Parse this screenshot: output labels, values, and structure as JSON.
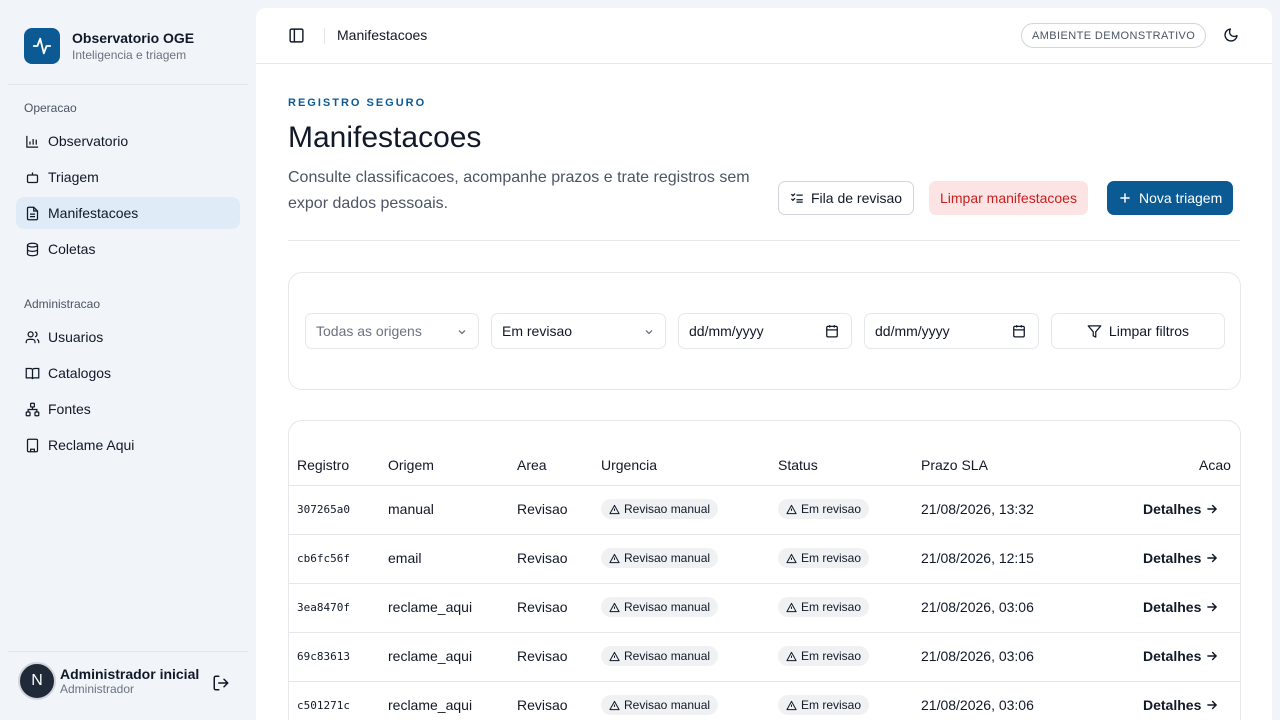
{
  "brand": {
    "title": "Observatorio OGE",
    "subtitle": "Inteligencia e triagem"
  },
  "sidebar": {
    "groups": [
      {
        "label": "Operacao",
        "items": [
          "Observatorio",
          "Triagem",
          "Manifestacoes",
          "Coletas"
        ]
      },
      {
        "label": "Administracao",
        "items": [
          "Usuarios",
          "Catalogos",
          "Fontes",
          "Reclame Aqui"
        ]
      }
    ],
    "active_item": "Manifestacoes"
  },
  "user": {
    "initial": "N",
    "name": "Administrador inicial",
    "role": "Administrador"
  },
  "topbar": {
    "title": "Manifestacoes",
    "env_badge": "AMBIENTE DEMONSTRATIVO"
  },
  "page": {
    "eyebrow": "REGISTRO SEGURO",
    "title": "Manifestacoes",
    "description": "Consulte classificacoes, acompanhe prazos e trate registros sem expor dados pessoais.",
    "actions": {
      "review_queue": "Fila de revisao",
      "clear_records": "Limpar manifestacoes",
      "new_triage": "Nova triagem"
    }
  },
  "filters": {
    "origin": {
      "value": "Todas as origens"
    },
    "status": {
      "value": "Em revisao"
    },
    "date_from": {
      "placeholder": "dd/mm/yyyy"
    },
    "date_to": {
      "placeholder": "dd/mm/yyyy"
    },
    "clear_label": "Limpar filtros"
  },
  "table": {
    "columns": [
      "Registro",
      "Origem",
      "Area",
      "Urgencia",
      "Status",
      "Prazo SLA",
      "Acao"
    ],
    "rows": [
      {
        "registro": "307265a0",
        "origem": "manual",
        "area": "Revisao",
        "urgencia": "Revisao manual",
        "status": "Em revisao",
        "prazo": "21/08/2026, 13:32",
        "acao": "Detalhes"
      },
      {
        "registro": "cb6fc56f",
        "origem": "email",
        "area": "Revisao",
        "urgencia": "Revisao manual",
        "status": "Em revisao",
        "prazo": "21/08/2026, 12:15",
        "acao": "Detalhes"
      },
      {
        "registro": "3ea8470f",
        "origem": "reclame_aqui",
        "area": "Revisao",
        "urgencia": "Revisao manual",
        "status": "Em revisao",
        "prazo": "21/08/2026, 03:06",
        "acao": "Detalhes"
      },
      {
        "registro": "69c83613",
        "origem": "reclame_aqui",
        "area": "Revisao",
        "urgencia": "Revisao manual",
        "status": "Em revisao",
        "prazo": "21/08/2026, 03:06",
        "acao": "Detalhes"
      },
      {
        "registro": "c501271c",
        "origem": "reclame_aqui",
        "area": "Revisao",
        "urgencia": "Revisao manual",
        "status": "Em revisao",
        "prazo": "21/08/2026, 03:06",
        "acao": "Detalhes"
      }
    ]
  },
  "colors": {
    "brand": "#0b5a94",
    "danger_bg": "#fde4e4",
    "danger_text": "#c81e1e",
    "active_nav": "#dfecf8"
  }
}
